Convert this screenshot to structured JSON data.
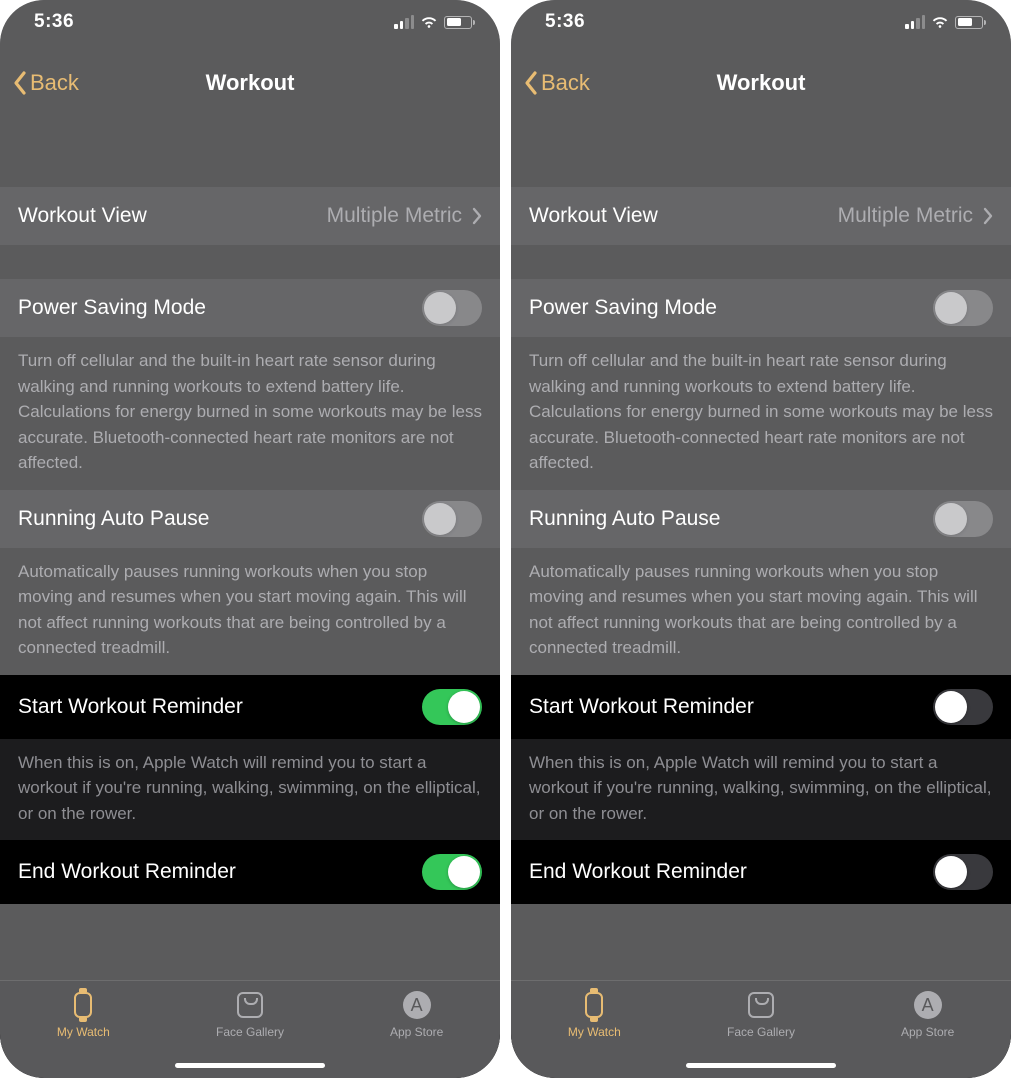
{
  "screens": [
    {
      "statusbar": {
        "time": "5:36"
      },
      "nav": {
        "back": "Back",
        "title": "Workout"
      },
      "rows": {
        "workout_view": {
          "label": "Workout View",
          "value": "Multiple Metric"
        },
        "power_saving": {
          "label": "Power Saving Mode",
          "on": false
        },
        "power_saving_footer": "Turn off cellular and the built-in heart rate sensor during walking and running workouts to extend battery life. Calculations for energy burned in some workouts may be less accurate. Bluetooth-connected heart rate monitors are not affected.",
        "auto_pause": {
          "label": "Running Auto Pause",
          "on": false
        },
        "auto_pause_footer": "Automatically pauses running workouts when you stop moving and resumes when you start moving again. This will not affect running workouts that are being controlled by a connected treadmill.",
        "start_reminder": {
          "label": "Start Workout Reminder",
          "on": true
        },
        "start_reminder_footer": "When this is on, Apple Watch will remind you to start a workout if you're running, walking, swimming, on the elliptical, or on the rower.",
        "end_reminder": {
          "label": "End Workout Reminder",
          "on": true
        }
      },
      "tabs": {
        "my_watch": "My Watch",
        "face_gallery": "Face Gallery",
        "app_store": "App Store"
      }
    },
    {
      "statusbar": {
        "time": "5:36"
      },
      "nav": {
        "back": "Back",
        "title": "Workout"
      },
      "rows": {
        "workout_view": {
          "label": "Workout View",
          "value": "Multiple Metric"
        },
        "power_saving": {
          "label": "Power Saving Mode",
          "on": false
        },
        "power_saving_footer": "Turn off cellular and the built-in heart rate sensor during walking and running workouts to extend battery life. Calculations for energy burned in some workouts may be less accurate. Bluetooth-connected heart rate monitors are not affected.",
        "auto_pause": {
          "label": "Running Auto Pause",
          "on": false
        },
        "auto_pause_footer": "Automatically pauses running workouts when you stop moving and resumes when you start moving again. This will not affect running workouts that are being controlled by a connected treadmill.",
        "start_reminder": {
          "label": "Start Workout Reminder",
          "on": false
        },
        "start_reminder_footer": "When this is on, Apple Watch will remind you to start a workout if you're running, walking, swimming, on the elliptical, or on the rower.",
        "end_reminder": {
          "label": "End Workout Reminder",
          "on": false
        }
      },
      "tabs": {
        "my_watch": "My Watch",
        "face_gallery": "Face Gallery",
        "app_store": "App Store"
      }
    }
  ]
}
